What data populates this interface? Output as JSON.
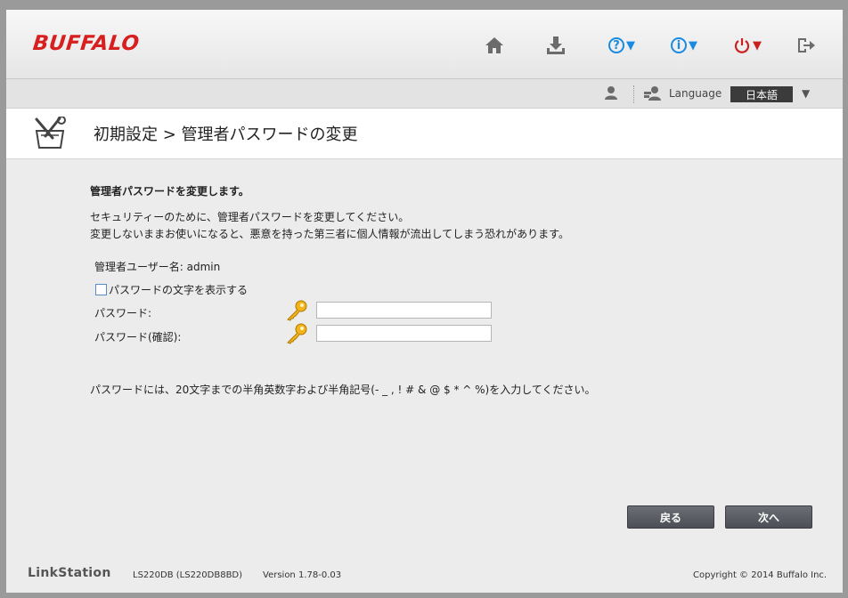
{
  "brand": {
    "logo": "BUFFALO"
  },
  "nav": {
    "help_caret": "▼",
    "info_caret": "▼",
    "power_caret": "▼"
  },
  "subbar": {
    "language_label": "Language",
    "language_value": "日本語",
    "language_caret": "▼"
  },
  "title": "初期設定 > 管理者パスワードの変更",
  "content": {
    "heading": "管理者パスワードを変更します。",
    "desc_line1": "セキュリティーのために、管理者パスワードを変更してください。",
    "desc_line2": "変更しないままお使いになると、悪意を持った第三者に個人情報が流出してしまう恐れがあります。",
    "admin_user": "管理者ユーザー名: admin",
    "show_password_label": "パスワードの文字を表示する",
    "password_label": "パスワード:",
    "password_confirm_label": "パスワード(確認):",
    "password_value": "",
    "password_confirm_value": "",
    "note": "パスワードには、20文字までの半角英数字および半角記号(- _ , ! # & @ $ * ^ %)を入力してください。"
  },
  "buttons": {
    "back": "戻る",
    "next": "次へ"
  },
  "footer": {
    "product": "LinkStation",
    "model": "LS220DB (LS220DB8BD)",
    "version": "Version 1.78-0.03",
    "copyright": "Copyright © 2014 Buffalo Inc."
  },
  "colors": {
    "brand_red": "#d81f1f",
    "accent_blue": "#1a8be0",
    "power_red": "#cc2020",
    "button_dark": "#55585e"
  },
  "icons": [
    "home-icon",
    "download-icon",
    "help-icon",
    "info-icon",
    "power-icon",
    "logout-icon",
    "user-icon",
    "users-icon",
    "tools-icon",
    "key-icon"
  ]
}
